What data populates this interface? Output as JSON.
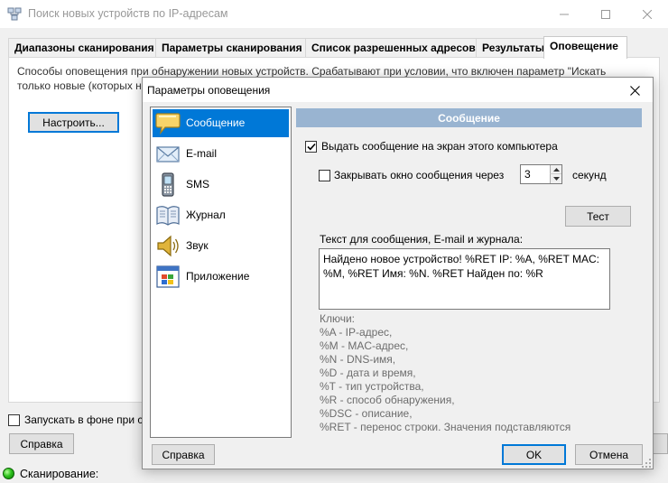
{
  "main": {
    "title": "Поиск новых устройств по IP-адресам",
    "tabs": [
      {
        "label": "Диапазоны сканирования"
      },
      {
        "label": "Параметры сканирования"
      },
      {
        "label": "Список разрешенных адресов"
      },
      {
        "label": "Результаты"
      },
      {
        "label": "Оповещение"
      }
    ],
    "active_tab": "Оповещение",
    "description_line1": "Способы оповещения при обнаружении новых устройств. Срабатывают при условии, что включен параметр \"Искать",
    "description_line2": "только новые (которых н",
    "configure_label": "Настроить...",
    "run_background_label": "Запускать в фоне при ст",
    "help_label": "Справка",
    "status_label": "Сканирование:",
    "status_color": "#2ec21d"
  },
  "dialog": {
    "title": "Параметры оповещения",
    "categories": [
      {
        "label": "Сообщение",
        "icon": "speech-bubble-icon",
        "selected": true
      },
      {
        "label": "E-mail",
        "icon": "envelope-icon",
        "selected": false
      },
      {
        "label": "SMS",
        "icon": "mobile-phone-icon",
        "selected": false
      },
      {
        "label": "Журнал",
        "icon": "log-book-icon",
        "selected": false
      },
      {
        "label": "Звук",
        "icon": "speaker-icon",
        "selected": false
      },
      {
        "label": "Приложение",
        "icon": "application-window-icon",
        "selected": false
      }
    ],
    "section_title": "Сообщение",
    "show_message_label": "Выдать сообщение на экран этого компьютера",
    "show_message_checked": true,
    "close_after_label": "Закрывать окно сообщения через",
    "close_after_checked": false,
    "close_after_seconds": "3",
    "seconds_label": "секунд",
    "test_label": "Тест",
    "message_text_label": "Текст для сообщения, E-mail и журнала:",
    "message_text": "Найдено новое устройство! %RET IP: %A, %RET MAC: %M, %RET Имя: %N. %RET Найден по: %R",
    "keys": [
      "Ключи:",
      "%A - IP-адрес,",
      "%M - MAC-адрес,",
      "%N - DNS-имя,",
      "%D - дата и время,",
      "%T - тип устройства,",
      "%R - способ обнаружения,",
      "%DSC - описание,",
      "%RET - перенос строки. Значения подставляются"
    ],
    "help_label": "Справка",
    "ok_label": "OK",
    "cancel_label": "Отмена",
    "colors": {
      "accent": "#0078d7",
      "section_header": "#99b4d1"
    }
  }
}
